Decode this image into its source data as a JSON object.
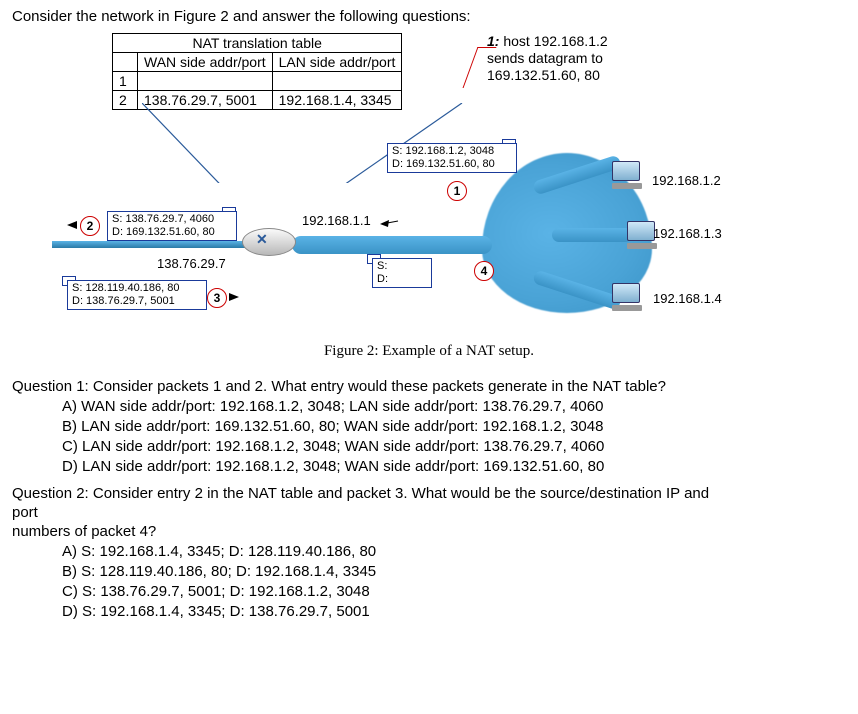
{
  "intro": "Consider the network in Figure 2 and answer the following questions:",
  "nat": {
    "title": "NAT translation table",
    "col_wan": "WAN side addr/port",
    "col_lan": "LAN side addr/port",
    "rows": [
      {
        "n": "1",
        "wan": "",
        "lan": ""
      },
      {
        "n": "2",
        "wan": "138.76.29.7, 5001",
        "lan": "192.168.1.4, 3345"
      }
    ]
  },
  "step1": {
    "bold": "1:",
    "l1": " host 192.168.1.2",
    "l2": "sends datagram to",
    "l3": "169.132.51.60, 80"
  },
  "pkt1": {
    "s": "S: 192.168.1.2, 3048",
    "d": "D: 169.132.51.60, 80"
  },
  "pkt2": {
    "s": "S: 138.76.29.7, 4060",
    "d": "D: 169.132.51.60, 80"
  },
  "pkt3": {
    "s": "S: 128.119.40.186, 80",
    "d": "D: 138.76.29.7, 5001"
  },
  "pktsd": {
    "s": "S:",
    "d": "D:"
  },
  "labels": {
    "router_lan": "192.168.1.1",
    "router_wan": "138.76.29.7",
    "ip1": "192.168.1.2",
    "ip2": "192.168.1.3",
    "ip3": "192.168.1.4"
  },
  "circles": {
    "c1": "1",
    "c2": "2",
    "c3": "3",
    "c4": "4"
  },
  "caption": "Figure 2: Example of a NAT setup.",
  "q1": {
    "text": "Question 1: Consider packets 1 and 2. What entry would these packets generate in the NAT table?",
    "a": "A) WAN side addr/port: 192.168.1.2, 3048; LAN side addr/port: 138.76.29.7, 4060",
    "b": "B) LAN side addr/port: 169.132.51.60, 80; WAN side addr/port: 192.168.1.2, 3048",
    "c": "C) LAN side addr/port: 192.168.1.2, 3048; WAN side addr/port: 138.76.29.7, 4060",
    "d": "D) LAN side addr/port: 192.168.1.2, 3048; WAN side addr/port: 169.132.51.60, 80"
  },
  "q2": {
    "l1": "Question 2: Consider entry 2 in the NAT table and packet 3. What would be the source/destination IP and",
    "l2": "port",
    "l3": "numbers of packet 4?",
    "a": "A) S: 192.168.1.4, 3345; D: 128.119.40.186, 80",
    "b": "B) S: 128.119.40.186, 80; D: 192.168.1.4, 3345",
    "c": "C) S: 138.76.29.7, 5001; D: 192.168.1.2, 3048",
    "d": "D) S: 192.168.1.4, 3345; D: 138.76.29.7, 5001"
  }
}
